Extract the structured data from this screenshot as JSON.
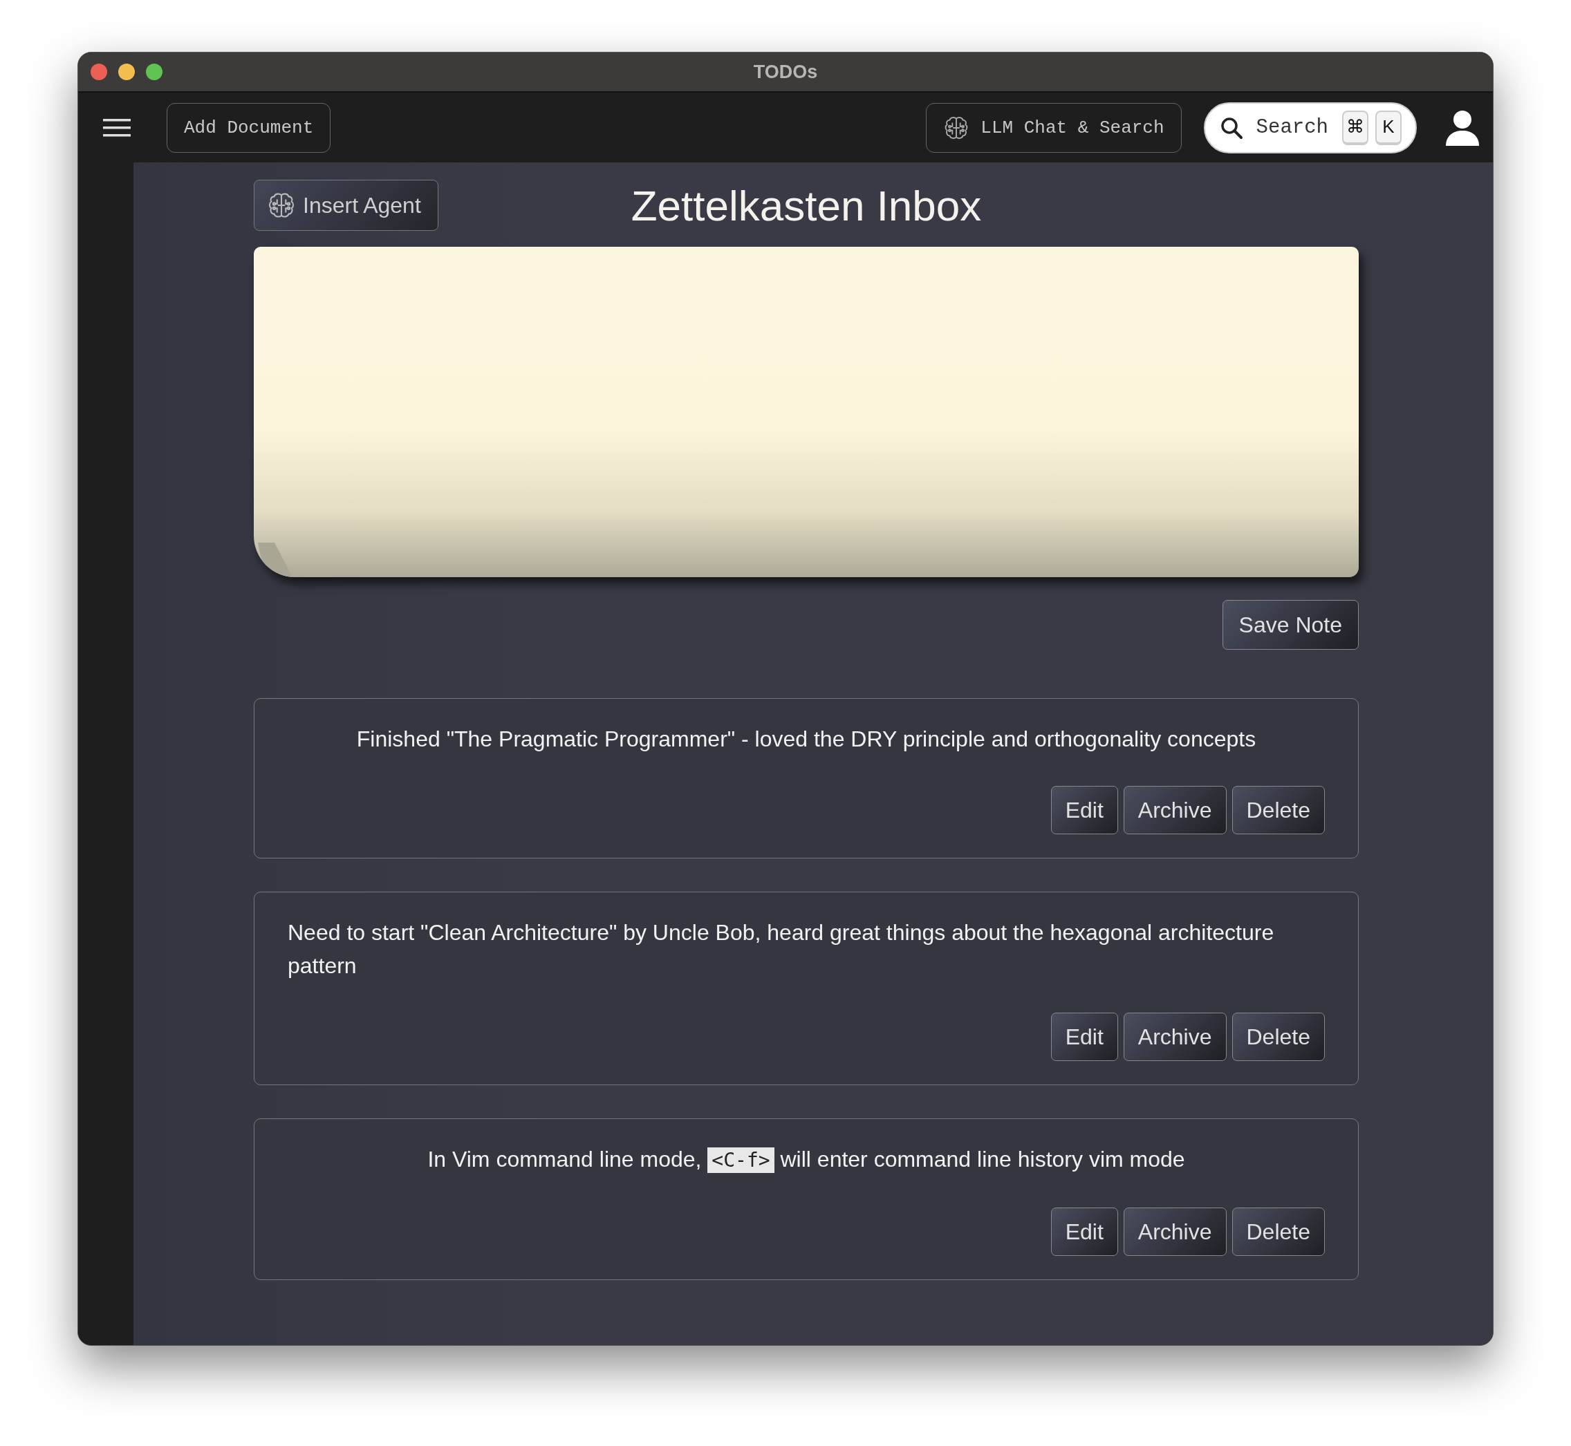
{
  "window": {
    "title": "TODOs"
  },
  "toolbar": {
    "add_button": "Add Document",
    "chat_button": "LLM Chat & Search",
    "search": {
      "placeholder": "Search",
      "keys": [
        "⌘",
        "K"
      ]
    }
  },
  "page": {
    "insert_button": "Insert Agent",
    "title": "Zettelkasten Inbox",
    "save_button": "Save Note"
  },
  "notes": [
    {
      "segments": [
        {
          "kind": "text",
          "text": "Finished \"The Pragmatic Programmer\" - loved the DRY principle and orthogonality concepts"
        }
      ],
      "actions": [
        "Edit",
        "Archive",
        "Delete"
      ]
    },
    {
      "segments": [
        {
          "kind": "text",
          "text": "Need to start \"Clean Architecture\" by Uncle Bob, heard great things about the hexagonal architecture pattern"
        }
      ],
      "actions": [
        "Edit",
        "Archive",
        "Delete"
      ]
    },
    {
      "segments": [
        {
          "kind": "text",
          "text": "In Vim command line mode, "
        },
        {
          "kind": "code",
          "text": "<C-f>"
        },
        {
          "kind": "text",
          "text": " will enter command line history vim mode"
        }
      ],
      "actions": [
        "Edit",
        "Archive",
        "Delete"
      ]
    }
  ]
}
